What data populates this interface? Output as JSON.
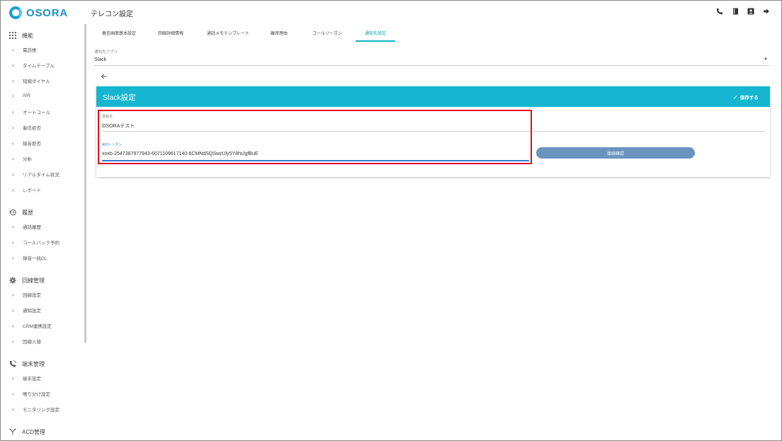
{
  "app": {
    "logo_text": "OSORA",
    "page_title": "テレコン設定"
  },
  "sidebar": {
    "sections": [
      {
        "label": "機能",
        "icon": "grid-icon",
        "items": [
          "電話帳",
          "タイムテーブル",
          "短縮ダイヤル",
          "IVR",
          "オートコール",
          "着信拒否",
          "録音拒否",
          "分析",
          "リアルタイム状況",
          "レポート"
        ]
      },
      {
        "label": "履歴",
        "icon": "history-icon",
        "items": [
          "通話履歴",
          "コールバック予約",
          "録音一括DL"
        ]
      },
      {
        "label": "回線管理",
        "icon": "gear-icon",
        "items": [
          "回線設定",
          "通知設定",
          "CRM連携設定",
          "回線入替"
        ]
      },
      {
        "label": "端末管理",
        "icon": "phone-icon",
        "items": [
          "端末設定",
          "鳴り分け設定",
          "モニタリング設定"
        ]
      },
      {
        "label": "ACD管理",
        "icon": "acd-icon",
        "items": []
      }
    ]
  },
  "header": {
    "icons": [
      "phone-icon",
      "book-icon",
      "contact-icon",
      "logout-icon"
    ]
  },
  "tabs": [
    {
      "label": "着信画面基本設定",
      "active": false
    },
    {
      "label": "回線詳細情報",
      "active": false
    },
    {
      "label": "通話メモテンプレート",
      "active": false
    },
    {
      "label": "離席理由",
      "active": false
    },
    {
      "label": "コールリーズン",
      "active": false
    },
    {
      "label": "通知先設定",
      "active": true
    }
  ],
  "notify_app": {
    "label": "通知先アプリ",
    "value": "Slack"
  },
  "card": {
    "title": "Slack設定",
    "save_label": "保存する",
    "name_field": {
      "label": "登録名",
      "value": "OSORAテスト"
    },
    "token_field": {
      "label": "APIトークン",
      "value": "xoxb-2547387977943-6071109617140-6CMNdSQSwzUly5Y8htJgfBuE"
    },
    "connect_label": "接続確認"
  },
  "colors": {
    "accent": "#17b6d0",
    "highlight": "#e1121c",
    "connect_button": "#6a93c0",
    "field_focus": "#2f7dd8"
  }
}
